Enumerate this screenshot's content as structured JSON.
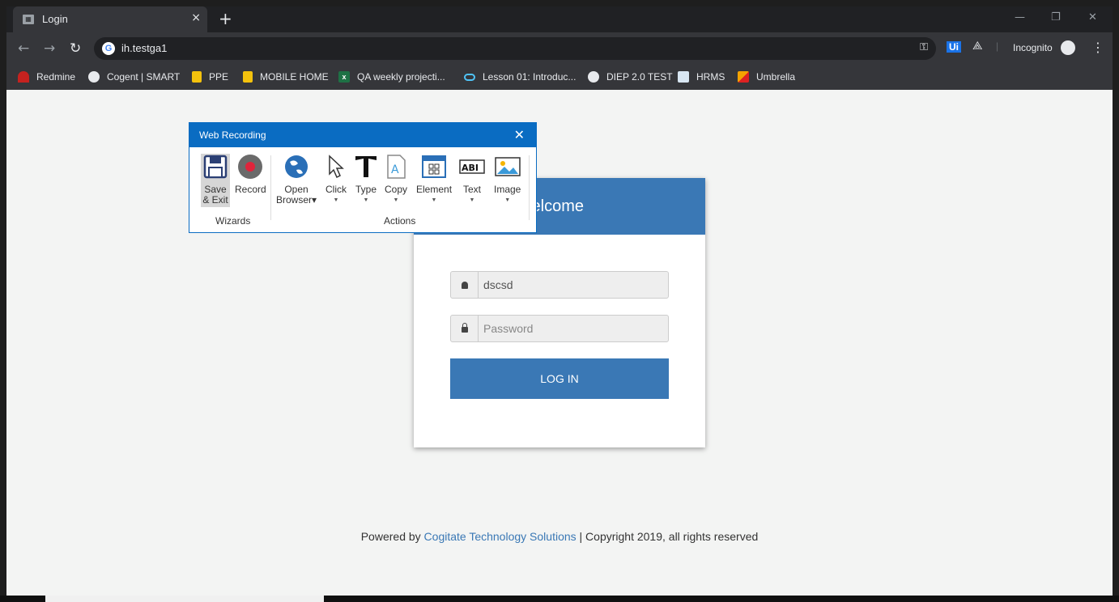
{
  "browser": {
    "tab_title": "Login",
    "tab_close": "×",
    "new_tab": "+",
    "url": "ih.testga1",
    "incognito_label": "Incognito",
    "extension_ui": "Ui",
    "window_controls": {
      "minimize": "—",
      "restore": "❐",
      "close": "✕"
    }
  },
  "bookmarks": [
    {
      "label": "Redmine",
      "icon": "redmine-icon"
    },
    {
      "label": "Cogent | SMART",
      "icon": "globe-icon"
    },
    {
      "label": "PPE",
      "icon": "folder-icon"
    },
    {
      "label": "MOBILE HOME",
      "icon": "folder-icon"
    },
    {
      "label": "QA weekly projecti...",
      "icon": "excel-icon"
    },
    {
      "label": "Lesson 01: Introduc...",
      "icon": "cloud-icon"
    },
    {
      "label": "DIEP 2.0 TEST",
      "icon": "globe-icon"
    },
    {
      "label": "HRMS",
      "icon": "hrms-icon"
    },
    {
      "label": "Umbrella",
      "icon": "umbrella-icon"
    }
  ],
  "recording": {
    "title": "Web Recording",
    "items": {
      "save_line1": "Save",
      "save_line2": "& Exit",
      "record": "Record",
      "open_line1": "Open",
      "open_line2": "Browser",
      "click": "Click",
      "type": "Type",
      "copy": "Copy",
      "element": "Element",
      "text": "Text",
      "image": "Image"
    },
    "groups": {
      "wizards": "Wizards",
      "actions": "Actions"
    }
  },
  "login": {
    "heading_visible": "/elcome",
    "username_value": "dscsd",
    "password_placeholder": "Password",
    "button": "LOG IN"
  },
  "footer": {
    "prefix": "Powered by",
    "link": "Cogitate Technology Solutions",
    "suffix": "| Copyright 2019, all rights reserved"
  }
}
